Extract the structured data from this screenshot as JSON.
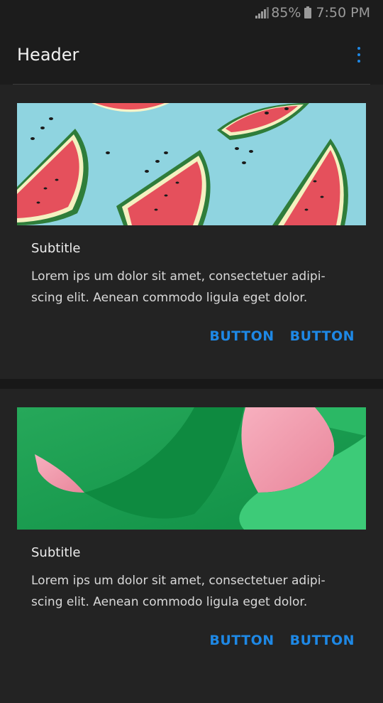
{
  "status": {
    "battery": "85%",
    "time": "7:50 PM"
  },
  "appbar": {
    "title": "Header",
    "menu_icon": "more-vert-icon",
    "accent": "#1e88e5"
  },
  "cards": [
    {
      "subtitle": "Subtitle",
      "body": "Lorem ips um dolor sit amet, consectetuer adipi-scing elit. Aenean commodo ligula eget dolor.",
      "buttons": [
        "BUTTON",
        "BUTTON"
      ]
    },
    {
      "subtitle": "Subtitle",
      "body": "Lorem ips um dolor sit amet, consectetuer adipi-scing elit. Aenean commodo ligula eget dolor.",
      "buttons": [
        "BUTTON",
        "BUTTON"
      ]
    }
  ]
}
